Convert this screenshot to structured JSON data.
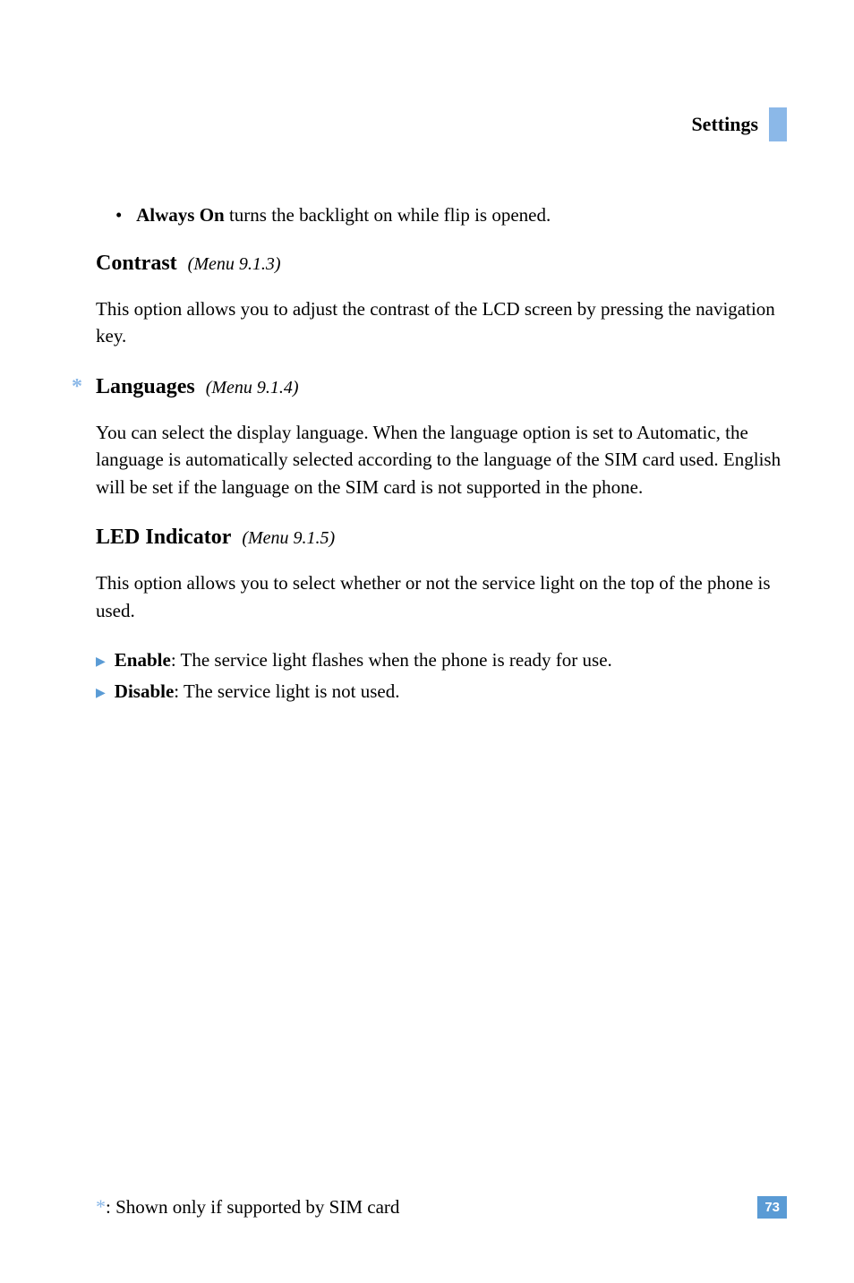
{
  "header": {
    "title": "Settings"
  },
  "bullet": {
    "marker": "•",
    "bold": "Always On",
    "rest": " turns the backlight on while flip is opened."
  },
  "section1": {
    "heading": "Contrast",
    "menu_ref": "(Menu 9.1.3)",
    "body": "This option allows you to adjust the contrast of the LCD screen by pressing the navigation key."
  },
  "section2": {
    "asterisk": "*",
    "heading": "Languages",
    "menu_ref": "(Menu 9.1.4)",
    "body": "You can select the display language. When the language option is set to Automatic, the language is automatically selected according to the language of the SIM card used. English will be set if the language on the SIM card is not supported in the phone."
  },
  "section3": {
    "heading": "LED Indicator",
    "menu_ref": "(Menu 9.1.5)",
    "body": "This option allows you to select whether or not the service light on the top of the phone is used.",
    "items": [
      {
        "bold": "Enable",
        "rest": ": The service light flashes when the phone is ready for use."
      },
      {
        "bold": "Disable",
        "rest": ": The service light is not used."
      }
    ]
  },
  "footer": {
    "asterisk": "*",
    "colon": ":",
    "note": "Shown only if supported by SIM card",
    "page_number": "73"
  }
}
